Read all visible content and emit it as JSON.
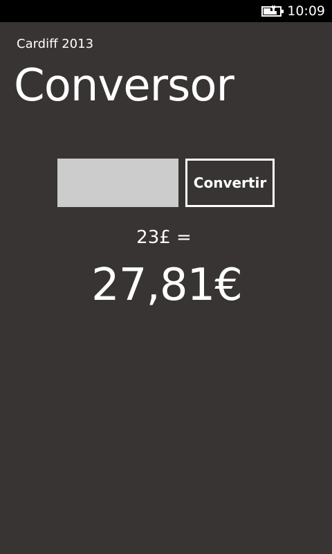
{
  "status_bar": {
    "battery_icon": "battery-charging-icon",
    "time": "10:09"
  },
  "app": {
    "title": "Cardiff 2013",
    "page_title": "Conversor"
  },
  "converter": {
    "input_value": "",
    "input_placeholder": "",
    "button_label": "Convertir",
    "source_text": "23£ =",
    "result_text": "27,81€"
  },
  "colors": {
    "background": "#383434",
    "status_bar": "#000000",
    "input_background": "#cccccc",
    "foreground": "#ffffff"
  }
}
